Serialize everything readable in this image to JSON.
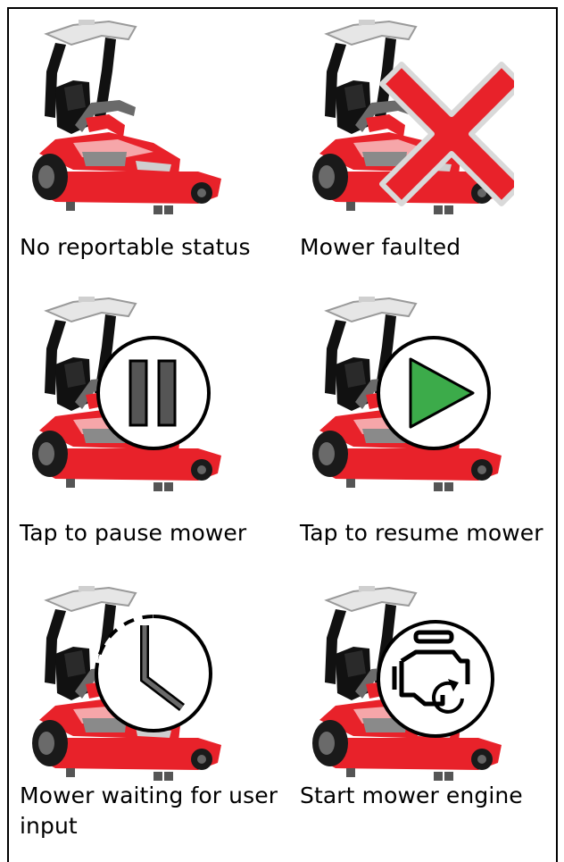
{
  "statuses": [
    {
      "label": "No reportable status",
      "icon": "mower-icon",
      "overlay": "none"
    },
    {
      "label": "Mower faulted",
      "icon": "mower-icon",
      "overlay": "red-x-icon"
    },
    {
      "label": "Tap to pause mower",
      "icon": "mower-icon",
      "overlay": "pause-icon"
    },
    {
      "label": "Tap to resume mower",
      "icon": "mower-icon",
      "overlay": "play-icon"
    },
    {
      "label": "Mower waiting for user input",
      "icon": "mower-icon",
      "overlay": "clock-icon"
    },
    {
      "label": "Start mower engine",
      "icon": "mower-icon",
      "overlay": "engine-icon"
    }
  ],
  "colors": {
    "mower_red": "#e8222a",
    "fault_red": "#e8222a",
    "play_green": "#3cab4a",
    "pause_gray": "#555555"
  }
}
